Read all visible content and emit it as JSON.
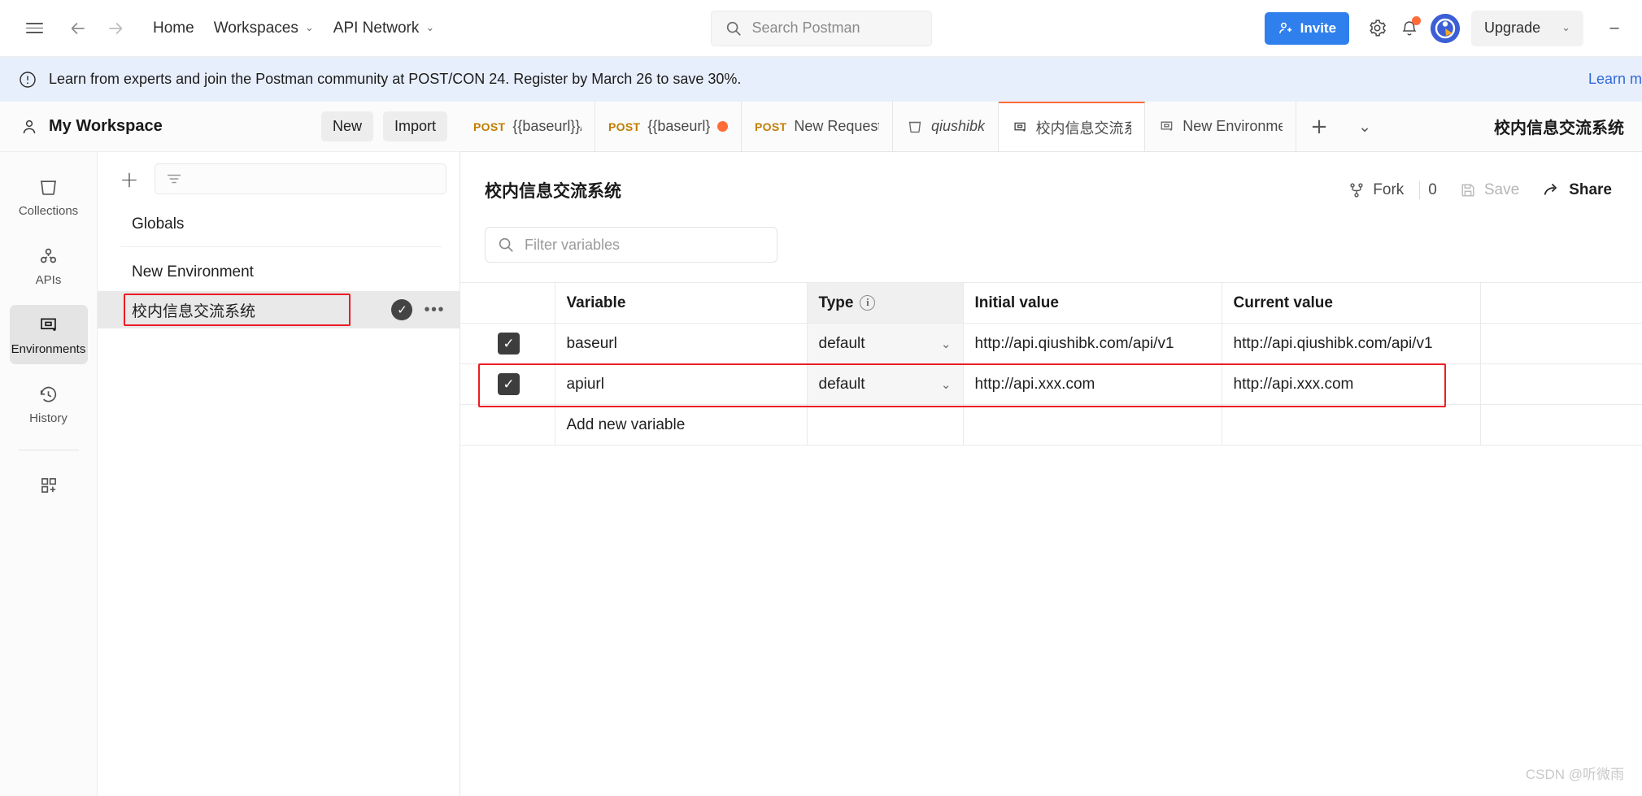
{
  "topbar": {
    "menu_icon": "hamburger-icon",
    "back_icon": "arrow-left-icon",
    "forward_icon": "arrow-right-icon",
    "home_label": "Home",
    "workspaces_label": "Workspaces",
    "api_network_label": "API Network",
    "search_placeholder": "Search Postman",
    "invite_label": "Invite",
    "settings_icon": "gear-icon",
    "notifications_icon": "bell-icon",
    "avatar_icon": "user-avatar",
    "upgrade_label": "Upgrade",
    "minimize_icon": "minimize-icon",
    "accent_blue": "#2f80ed",
    "notification_dot_color": "#ff6c37"
  },
  "banner": {
    "icon": "info-circle-icon",
    "text": "Learn from experts and join the Postman community at POST/CON 24. Register by March 26 to save 30%.",
    "link_label": "Learn m",
    "background": "#e8effc",
    "link_color": "#2f68d9"
  },
  "rail": {
    "items": [
      {
        "label": "Collections",
        "icon": "collections-icon",
        "active": false
      },
      {
        "label": "APIs",
        "icon": "apis-icon",
        "active": false
      },
      {
        "label": "Environments",
        "icon": "environments-icon",
        "active": true
      },
      {
        "label": "History",
        "icon": "history-icon",
        "active": false
      }
    ],
    "more_icon": "add-modules-icon"
  },
  "workspace": {
    "icon": "user-icon",
    "name": "My Workspace",
    "new_label": "New",
    "import_label": "Import"
  },
  "env_panel": {
    "add_icon": "plus-icon",
    "filter_icon": "filter-icon",
    "filter_placeholder": "",
    "globals_label": "Globals",
    "items": [
      {
        "name": "New Environment",
        "selected": false,
        "highlighted": false
      },
      {
        "name": "校内信息交流系统",
        "selected": true,
        "highlighted": true,
        "check_icon": "check-icon",
        "more_icon": "more-dots-icon"
      }
    ],
    "highlight_color": "#ec1c24"
  },
  "tabs": {
    "items": [
      {
        "method": "POST",
        "label": "{{baseurl}}/fee",
        "type": "request",
        "active": false,
        "unsaved": false
      },
      {
        "method": "POST",
        "label": "{{baseurl}}/",
        "type": "request",
        "active": false,
        "unsaved": true
      },
      {
        "method": "POST",
        "label": "New Request",
        "type": "request",
        "active": false,
        "unsaved": false
      },
      {
        "method": "",
        "label": "qiushibk",
        "type": "collection",
        "icon": "collection-icon",
        "active": false,
        "italic": true
      },
      {
        "method": "",
        "label": "校内信息交流系",
        "type": "environment",
        "icon": "environment-icon",
        "active": true
      },
      {
        "method": "",
        "label": "New Environme",
        "type": "environment",
        "icon": "environment-icon",
        "active": false
      }
    ],
    "add_icon": "plus-icon",
    "chevron_icon": "chevron-down-icon",
    "selected_environment": "校内信息交流系统"
  },
  "content": {
    "title": "校内信息交流系统",
    "fork_icon": "fork-icon",
    "fork_label": "Fork",
    "fork_count": "0",
    "save_icon": "save-icon",
    "save_label": "Save",
    "share_icon": "share-icon",
    "share_label": "Share",
    "filter_placeholder": "Filter variables",
    "search_icon": "search-icon",
    "table": {
      "headers": [
        "Variable",
        "Type",
        "Initial value",
        "Current value"
      ],
      "type_info_icon": "info-icon",
      "rows": [
        {
          "checked": true,
          "variable": "baseurl",
          "type": "default",
          "initial_value": "http://api.qiushibk.com/api/v1",
          "current_value": "http://api.qiushibk.com/api/v1",
          "highlighted": true
        },
        {
          "checked": true,
          "variable": "apiurl",
          "type": "default",
          "initial_value": "http://api.xxx.com",
          "current_value": "http://api.xxx.com",
          "highlighted": false
        }
      ],
      "add_row_placeholder": "Add new variable"
    }
  },
  "watermark": "CSDN @听微雨"
}
